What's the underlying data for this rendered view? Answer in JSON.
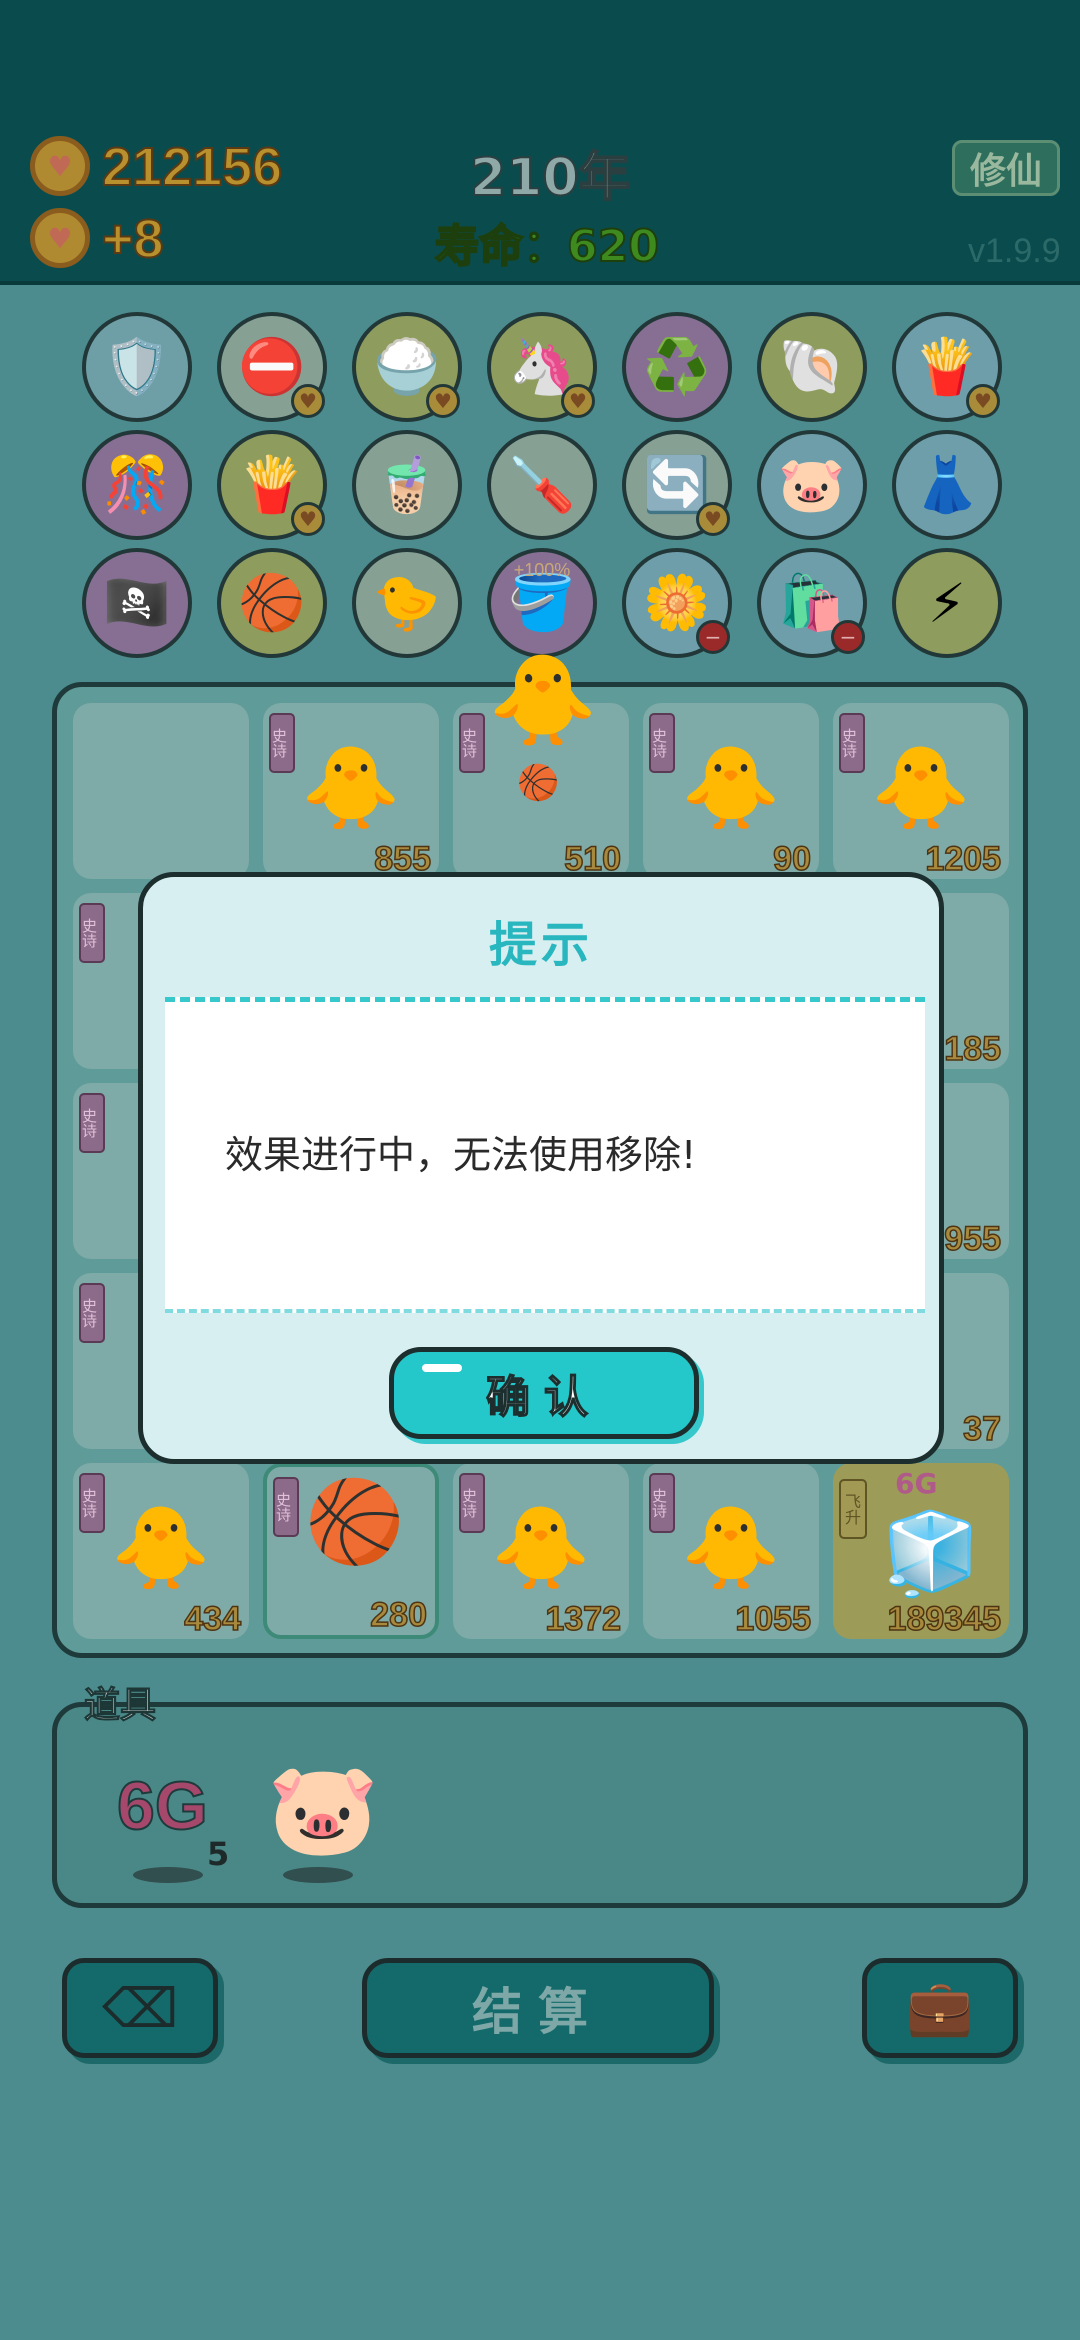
{
  "header": {
    "coins": "212156",
    "income": "+8",
    "year": "210年",
    "lifespan": "寿命：620",
    "xiuxian_label": "修仙",
    "version": "v1.9.9"
  },
  "items_row1": [
    "wrench-shield",
    "no-entry",
    "rice-bowl",
    "unicorn",
    "recycle",
    "shell",
    "fries"
  ],
  "items_row2": [
    "gift-spray",
    "fries",
    "bubble-tea",
    "screwdriver",
    "cycle",
    "piggy-bank",
    "skirt"
  ],
  "items_row3": [
    "eye-patch",
    "basketballs",
    "chick",
    "bucket",
    "flower-pot",
    "garbage-bag",
    "lightning"
  ],
  "items_pct_label": "+100%",
  "board": {
    "tile_tag": "史诗",
    "fly_tag": "飞升",
    "badge_6g": "6G",
    "row1": [
      "",
      "855",
      "510",
      "90",
      "1205"
    ],
    "row2_right": "185",
    "row3_right": "955",
    "row4_right": "37",
    "row5": [
      "434",
      "280",
      "1372",
      "1055",
      "189345"
    ]
  },
  "items_panel": {
    "title": "道具",
    "item_6g_label": "6G",
    "item_6g_count": "5"
  },
  "buttons": {
    "settle": "结算"
  },
  "dialog": {
    "title": "提示",
    "message": "效果进行中，无法使用移除!",
    "confirm": "确认"
  }
}
